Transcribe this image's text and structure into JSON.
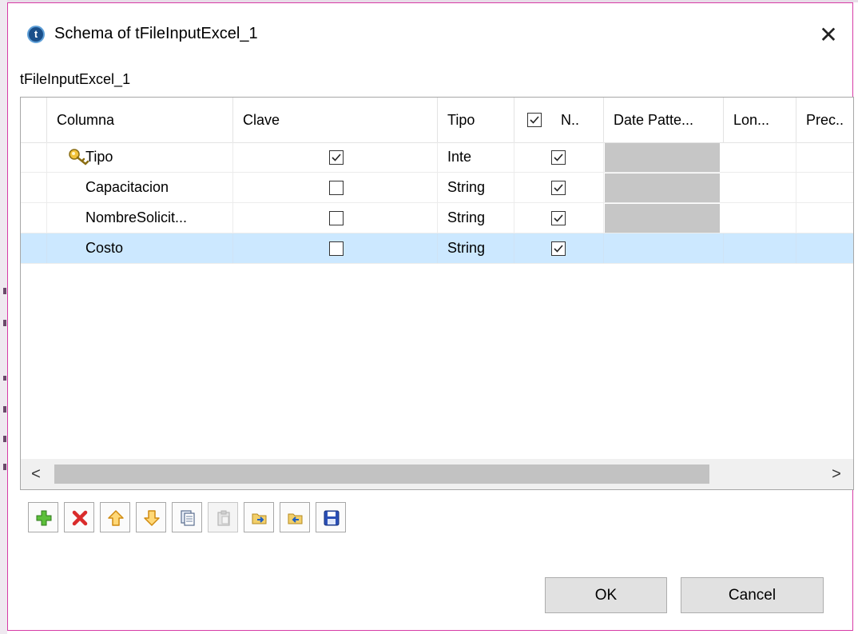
{
  "window": {
    "title": "Schema of tFileInputExcel_1",
    "close_glyph": "✕",
    "app_icon": "talend-logo-icon",
    "app_icon_glyph": "t"
  },
  "subtitle": "tFileInputExcel_1",
  "table": {
    "headers": {
      "columna": "Columna",
      "clave": "Clave",
      "tipo": "Tipo",
      "nullable": "N..",
      "date_pattern": "Date Patte...",
      "length": "Lon...",
      "precision": "Prec.."
    },
    "nullable_header_checked": true,
    "rows": [
      {
        "name": "Tipo",
        "key": true,
        "type": "Inte",
        "nullable": true,
        "date_disabled": true,
        "selected": false,
        "key_icon": true
      },
      {
        "name": "Capacitacion",
        "key": false,
        "type": "String",
        "nullable": true,
        "date_disabled": true,
        "selected": false,
        "key_icon": false
      },
      {
        "name": "NombreSolicit...",
        "key": false,
        "type": "String",
        "nullable": true,
        "date_disabled": true,
        "selected": false,
        "key_icon": false
      },
      {
        "name": "Costo",
        "key": false,
        "type": "String",
        "nullable": true,
        "date_disabled": false,
        "selected": true,
        "key_icon": false
      }
    ],
    "scroll_left": "<",
    "scroll_right": ">"
  },
  "toolbar": {
    "buttons": [
      {
        "name": "add-icon",
        "enabled": true
      },
      {
        "name": "delete-icon",
        "enabled": true
      },
      {
        "name": "move-up-icon",
        "enabled": true
      },
      {
        "name": "move-down-icon",
        "enabled": true
      },
      {
        "name": "copy-icon",
        "enabled": true
      },
      {
        "name": "paste-icon",
        "enabled": false
      },
      {
        "name": "import-icon",
        "enabled": true
      },
      {
        "name": "export-icon",
        "enabled": true
      },
      {
        "name": "save-icon",
        "enabled": true
      }
    ]
  },
  "buttons": {
    "ok": "OK",
    "cancel": "Cancel"
  },
  "colors": {
    "dialog_border": "#d63ca6",
    "selected_row": "#cce8ff",
    "disabled_cell": "#c6c6c6",
    "add_green": "#3c9a2c",
    "delete_red": "#d92b2b",
    "arrow_orange": "#f0a020",
    "save_blue": "#1d3c9e"
  }
}
